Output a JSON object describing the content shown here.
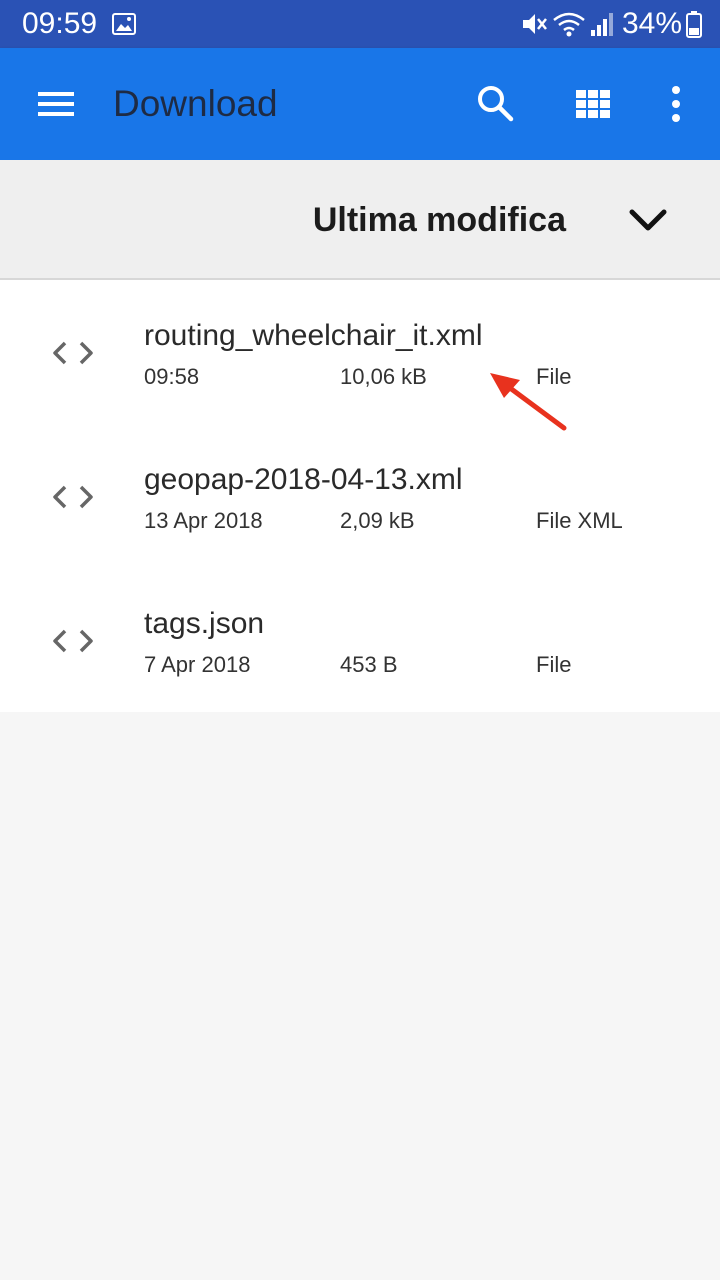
{
  "status_bar": {
    "time": "09:59",
    "battery": "34%",
    "icons": [
      "image-icon",
      "mute-icon",
      "wifi-icon",
      "signal-icon",
      "battery-icon"
    ]
  },
  "app_bar": {
    "title": "Download",
    "icons": [
      "menu-icon",
      "search-icon",
      "grid-view-icon",
      "more-options-icon"
    ],
    "color": "#1976e8"
  },
  "sort": {
    "label": "Ultima modifica",
    "icon": "chevron-down-icon"
  },
  "files": [
    {
      "name": "routing_wheelchair_it.xml",
      "date": "09:58",
      "size": "10,06 kB",
      "type": "File",
      "icon": "code-file-icon"
    },
    {
      "name": "geopap-2018-04-13.xml",
      "date": "13 Apr 2018",
      "size": "2,09 kB",
      "type": "File XML",
      "icon": "code-file-icon"
    },
    {
      "name": "tags.json",
      "date": "7 Apr 2018",
      "size": "453 B",
      "type": "File",
      "icon": "code-file-icon"
    }
  ],
  "annotation": {
    "color": "#e8321e",
    "icon": "red-arrow-annotation"
  }
}
